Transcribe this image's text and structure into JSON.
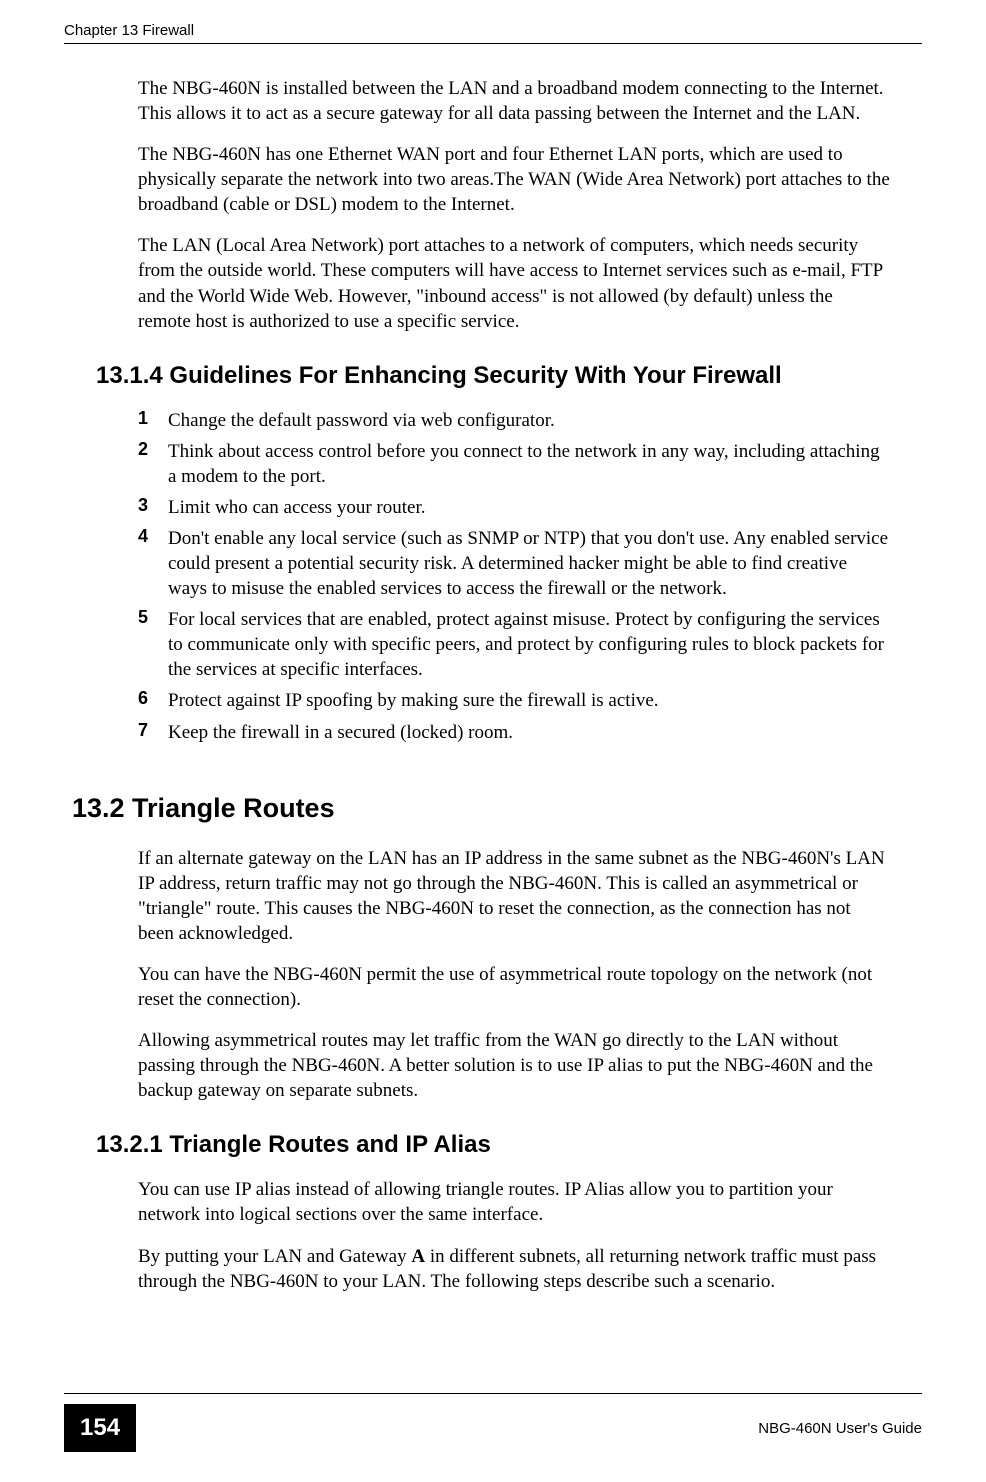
{
  "header": {
    "chapter": "Chapter 13 Firewall"
  },
  "paragraphs": {
    "p1": "The NBG-460N is installed between the LAN and a broadband modem connecting to the Internet. This allows it to act as a secure gateway for all data passing between the Internet and the LAN.",
    "p2": "The NBG-460N has one Ethernet WAN port and four Ethernet LAN ports, which are used to physically separate the network into two areas.The WAN (Wide Area Network) port attaches to the broadband (cable or DSL) modem to the Internet.",
    "p3": "The LAN (Local Area Network) port attaches to a network of computers, which needs security from the outside world. These computers will have access to Internet services such as e-mail, FTP and the World Wide Web. However, \"inbound access\" is not allowed (by default) unless the remote host is authorized to use a specific service.",
    "p4": "If an alternate gateway on the LAN has an IP address in the same subnet as the NBG-460N's LAN IP address, return traffic may not go through the NBG-460N. This is called an asymmetrical or \"triangle\" route. This causes the NBG-460N to reset the connection, as the connection has not been acknowledged.",
    "p5": "You can have the NBG-460N permit the use of asymmetrical route topology on the network (not reset the connection).",
    "p6": "Allowing asymmetrical routes may let traffic from the WAN go directly to the LAN without passing through the NBG-460N. A better solution is to use IP alias to put the NBG-460N and the backup gateway on separate subnets.",
    "p7": "You can use IP alias instead of allowing triangle routes. IP Alias allow you to partition your network into logical sections over the same interface.",
    "p8_pre": "By putting your LAN and Gateway ",
    "p8_bold": "A",
    "p8_post": " in different subnets, all returning network traffic must pass through the NBG-460N to your LAN. The following steps describe such a scenario."
  },
  "sections": {
    "s1314": "13.1.4  Guidelines For Enhancing Security With Your Firewall",
    "s132": "13.2  Triangle Routes",
    "s1321": "13.2.1  Triangle Routes and IP Alias"
  },
  "guidelines": [
    {
      "num": "1",
      "text": "Change the default password via web configurator."
    },
    {
      "num": "2",
      "text": "Think about access control before you connect to the network in any way, including attaching a modem to the port."
    },
    {
      "num": "3",
      "text": "Limit who can access your router."
    },
    {
      "num": "4",
      "text": "Don't enable any local service (such as SNMP or NTP) that you don't use. Any enabled service could present a potential security risk. A determined hacker might be able to find creative ways to misuse the enabled services to access the firewall or the network."
    },
    {
      "num": "5",
      "text": "For local services that are enabled, protect against misuse. Protect by configuring the services to communicate only with specific peers, and protect by configuring rules to block packets for the services at specific interfaces."
    },
    {
      "num": "6",
      "text": "Protect against IP spoofing by making sure the firewall is active."
    },
    {
      "num": "7",
      "text": "Keep the firewall in a secured (locked) room."
    }
  ],
  "footer": {
    "page": "154",
    "guide": "NBG-460N User's Guide"
  }
}
